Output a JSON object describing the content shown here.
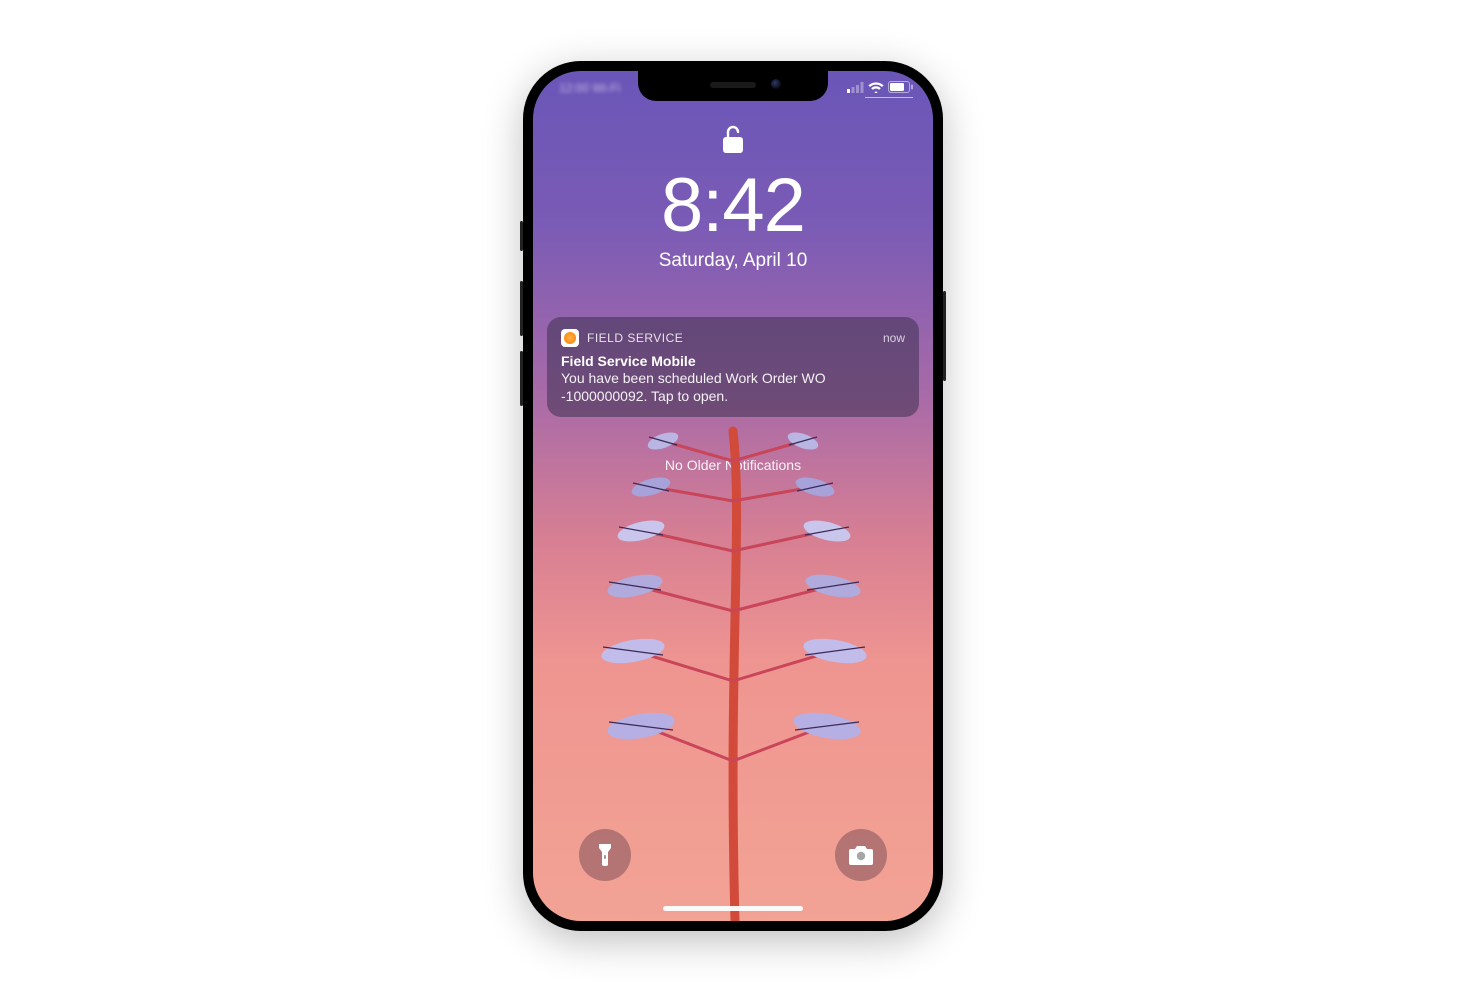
{
  "status": {
    "left_text": "12:00 Wi-Fi"
  },
  "lock": {
    "time": "8:42",
    "date": "Saturday, April 10"
  },
  "notification": {
    "app_name": "FIELD SERVICE",
    "timestamp": "now",
    "title": "Field Service Mobile",
    "body": "You have been scheduled Work Order WO -1000000092. Tap to open."
  },
  "older_label": "No Older Notifications"
}
